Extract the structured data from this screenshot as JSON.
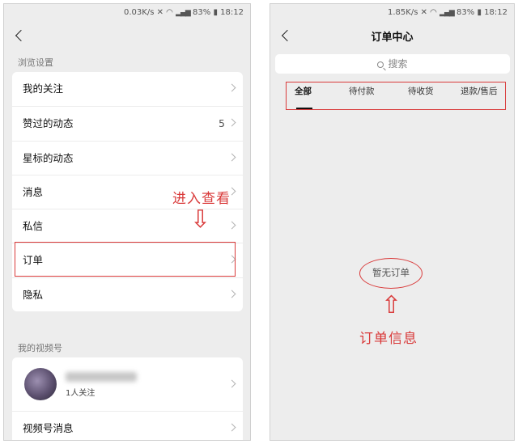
{
  "left": {
    "status": {
      "speed": "0.03K/s",
      "battery": "83%",
      "time": "18:12"
    },
    "sections": {
      "browse": "浏览设置",
      "video": "我的视频号"
    },
    "browse_items": [
      {
        "label": "我的关注"
      },
      {
        "label": "赞过的动态",
        "count": "5"
      },
      {
        "label": "星标的动态"
      },
      {
        "label": "消息"
      },
      {
        "label": "私信"
      },
      {
        "label": "订单"
      },
      {
        "label": "隐私"
      }
    ],
    "video": {
      "followers": "1人关注",
      "message_item": "视频号消息"
    },
    "annotation": {
      "text": "进入查看",
      "arrow": "⇩"
    }
  },
  "right": {
    "status": {
      "speed": "1.85K/s",
      "battery": "83%",
      "time": "18:12"
    },
    "title": "订单中心",
    "search_placeholder": "搜索",
    "tabs": [
      "全部",
      "待付款",
      "待收货",
      "退款/售后"
    ],
    "empty_text": "暂无订单",
    "annotation": {
      "text": "订单信息",
      "arrow": "⇧"
    }
  },
  "colors": {
    "annotation": "#d93a3a",
    "background": "#ededed",
    "card": "#ffffff"
  },
  "icons": [
    "back-arrow-icon",
    "chevron-right-icon",
    "search-icon",
    "wifi-icon",
    "signal-icon",
    "battery-icon",
    "mute-icon"
  ]
}
